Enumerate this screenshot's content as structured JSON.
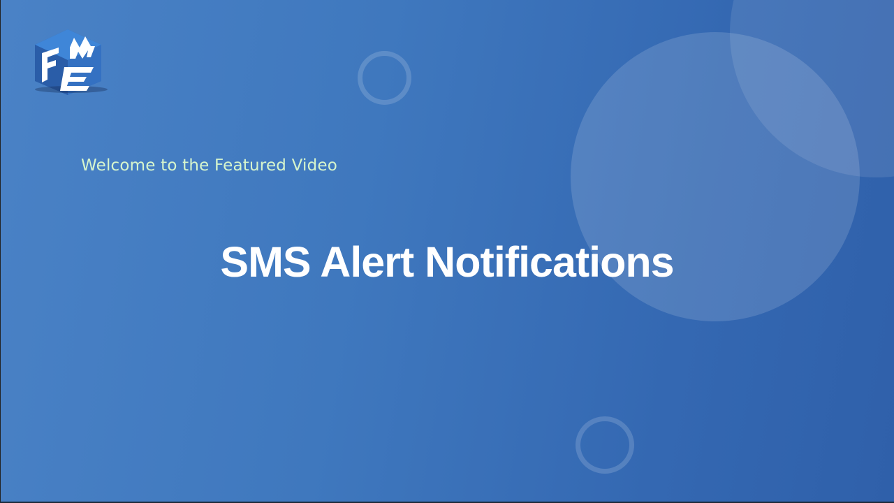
{
  "slide": {
    "welcome_text": "Welcome to the Featured Video",
    "title": "SMS Alert Notifications"
  },
  "logo": {
    "name": "fme-logo",
    "letters": [
      "F",
      "M",
      "E"
    ]
  },
  "colors": {
    "background_start": "#4a82c6",
    "background_end": "#2f60aa",
    "welcome_text": "#d6f5cd",
    "title_text": "#ffffff"
  }
}
